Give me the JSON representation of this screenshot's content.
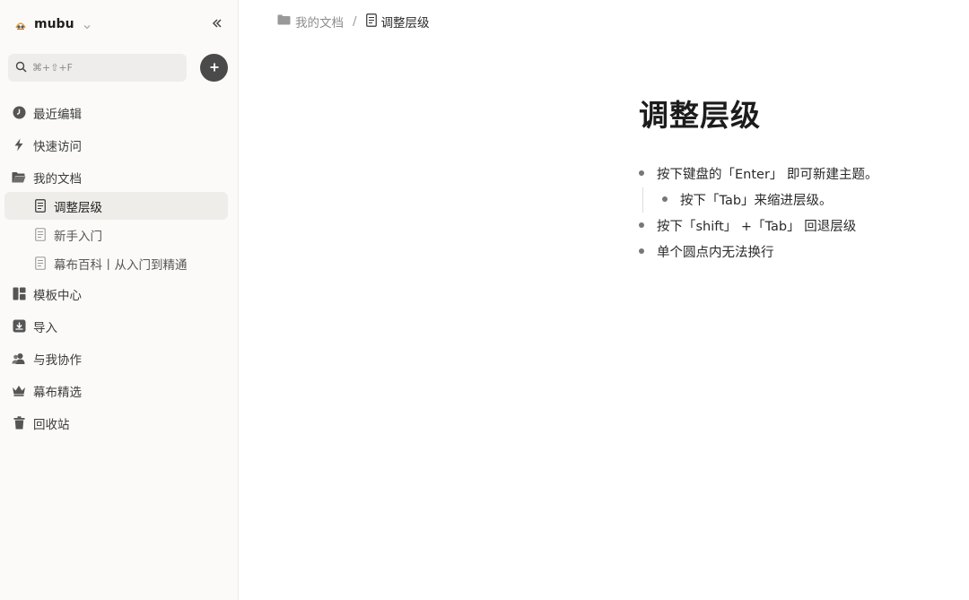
{
  "app": {
    "name": "mubu",
    "colors": {
      "sidebar_bg": "#fbfaf9",
      "active_item_bg": "#efedea",
      "add_button": "#4a4a4a"
    }
  },
  "search": {
    "placeholder": "⌘+⇧+F"
  },
  "sidebar": {
    "nav": [
      {
        "label": "最近编辑",
        "icon": "clock-icon"
      },
      {
        "label": "快速访问",
        "icon": "lightning-icon"
      },
      {
        "label": "我的文档",
        "icon": "folder-open-icon"
      }
    ],
    "docs": [
      {
        "label": "调整层级",
        "icon": "document-icon",
        "active": true
      },
      {
        "label": "新手入门",
        "icon": "document-icon"
      },
      {
        "label": "幕布百科丨从入门到精通",
        "icon": "document-icon"
      }
    ],
    "nav2": [
      {
        "label": "模板中心",
        "icon": "template-icon"
      },
      {
        "label": "导入",
        "icon": "import-icon"
      },
      {
        "label": "与我协作",
        "icon": "collaborators-icon"
      },
      {
        "label": "幕布精选",
        "icon": "crown-icon"
      },
      {
        "label": "回收站",
        "icon": "trash-icon"
      }
    ]
  },
  "breadcrumb": {
    "parent": "我的文档",
    "separator": "/",
    "current": "调整层级"
  },
  "document": {
    "title": "调整层级",
    "bullets": [
      {
        "text": "按下键盘的「Enter」 即可新建主题。",
        "level": 0
      },
      {
        "text": "按下「Tab」来缩进层级。",
        "level": 1
      },
      {
        "text": "按下「shift」 +「Tab」 回退层级",
        "level": 0
      },
      {
        "text": "单个圆点内无法换行",
        "level": 0
      }
    ]
  }
}
